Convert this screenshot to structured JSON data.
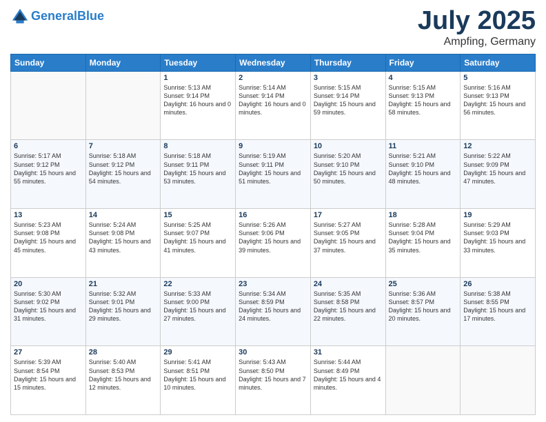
{
  "header": {
    "logo_line1": "General",
    "logo_line2": "Blue",
    "month": "July 2025",
    "location": "Ampfing, Germany"
  },
  "days_of_week": [
    "Sunday",
    "Monday",
    "Tuesday",
    "Wednesday",
    "Thursday",
    "Friday",
    "Saturday"
  ],
  "weeks": [
    [
      {
        "day": "",
        "empty": true
      },
      {
        "day": "",
        "empty": true
      },
      {
        "day": "1",
        "sunrise": "5:13 AM",
        "sunset": "9:14 PM",
        "daylight": "16 hours and 0 minutes."
      },
      {
        "day": "2",
        "sunrise": "5:14 AM",
        "sunset": "9:14 PM",
        "daylight": "16 hours and 0 minutes."
      },
      {
        "day": "3",
        "sunrise": "5:15 AM",
        "sunset": "9:14 PM",
        "daylight": "15 hours and 59 minutes."
      },
      {
        "day": "4",
        "sunrise": "5:15 AM",
        "sunset": "9:13 PM",
        "daylight": "15 hours and 58 minutes."
      },
      {
        "day": "5",
        "sunrise": "5:16 AM",
        "sunset": "9:13 PM",
        "daylight": "15 hours and 56 minutes."
      }
    ],
    [
      {
        "day": "6",
        "sunrise": "5:17 AM",
        "sunset": "9:12 PM",
        "daylight": "15 hours and 55 minutes."
      },
      {
        "day": "7",
        "sunrise": "5:18 AM",
        "sunset": "9:12 PM",
        "daylight": "15 hours and 54 minutes."
      },
      {
        "day": "8",
        "sunrise": "5:18 AM",
        "sunset": "9:11 PM",
        "daylight": "15 hours and 53 minutes."
      },
      {
        "day": "9",
        "sunrise": "5:19 AM",
        "sunset": "9:11 PM",
        "daylight": "15 hours and 51 minutes."
      },
      {
        "day": "10",
        "sunrise": "5:20 AM",
        "sunset": "9:10 PM",
        "daylight": "15 hours and 50 minutes."
      },
      {
        "day": "11",
        "sunrise": "5:21 AM",
        "sunset": "9:10 PM",
        "daylight": "15 hours and 48 minutes."
      },
      {
        "day": "12",
        "sunrise": "5:22 AM",
        "sunset": "9:09 PM",
        "daylight": "15 hours and 47 minutes."
      }
    ],
    [
      {
        "day": "13",
        "sunrise": "5:23 AM",
        "sunset": "9:08 PM",
        "daylight": "15 hours and 45 minutes."
      },
      {
        "day": "14",
        "sunrise": "5:24 AM",
        "sunset": "9:08 PM",
        "daylight": "15 hours and 43 minutes."
      },
      {
        "day": "15",
        "sunrise": "5:25 AM",
        "sunset": "9:07 PM",
        "daylight": "15 hours and 41 minutes."
      },
      {
        "day": "16",
        "sunrise": "5:26 AM",
        "sunset": "9:06 PM",
        "daylight": "15 hours and 39 minutes."
      },
      {
        "day": "17",
        "sunrise": "5:27 AM",
        "sunset": "9:05 PM",
        "daylight": "15 hours and 37 minutes."
      },
      {
        "day": "18",
        "sunrise": "5:28 AM",
        "sunset": "9:04 PM",
        "daylight": "15 hours and 35 minutes."
      },
      {
        "day": "19",
        "sunrise": "5:29 AM",
        "sunset": "9:03 PM",
        "daylight": "15 hours and 33 minutes."
      }
    ],
    [
      {
        "day": "20",
        "sunrise": "5:30 AM",
        "sunset": "9:02 PM",
        "daylight": "15 hours and 31 minutes."
      },
      {
        "day": "21",
        "sunrise": "5:32 AM",
        "sunset": "9:01 PM",
        "daylight": "15 hours and 29 minutes."
      },
      {
        "day": "22",
        "sunrise": "5:33 AM",
        "sunset": "9:00 PM",
        "daylight": "15 hours and 27 minutes."
      },
      {
        "day": "23",
        "sunrise": "5:34 AM",
        "sunset": "8:59 PM",
        "daylight": "15 hours and 24 minutes."
      },
      {
        "day": "24",
        "sunrise": "5:35 AM",
        "sunset": "8:58 PM",
        "daylight": "15 hours and 22 minutes."
      },
      {
        "day": "25",
        "sunrise": "5:36 AM",
        "sunset": "8:57 PM",
        "daylight": "15 hours and 20 minutes."
      },
      {
        "day": "26",
        "sunrise": "5:38 AM",
        "sunset": "8:55 PM",
        "daylight": "15 hours and 17 minutes."
      }
    ],
    [
      {
        "day": "27",
        "sunrise": "5:39 AM",
        "sunset": "8:54 PM",
        "daylight": "15 hours and 15 minutes."
      },
      {
        "day": "28",
        "sunrise": "5:40 AM",
        "sunset": "8:53 PM",
        "daylight": "15 hours and 12 minutes."
      },
      {
        "day": "29",
        "sunrise": "5:41 AM",
        "sunset": "8:51 PM",
        "daylight": "15 hours and 10 minutes."
      },
      {
        "day": "30",
        "sunrise": "5:43 AM",
        "sunset": "8:50 PM",
        "daylight": "15 hours and 7 minutes."
      },
      {
        "day": "31",
        "sunrise": "5:44 AM",
        "sunset": "8:49 PM",
        "daylight": "15 hours and 4 minutes."
      },
      {
        "day": "",
        "empty": true
      },
      {
        "day": "",
        "empty": true
      }
    ]
  ]
}
